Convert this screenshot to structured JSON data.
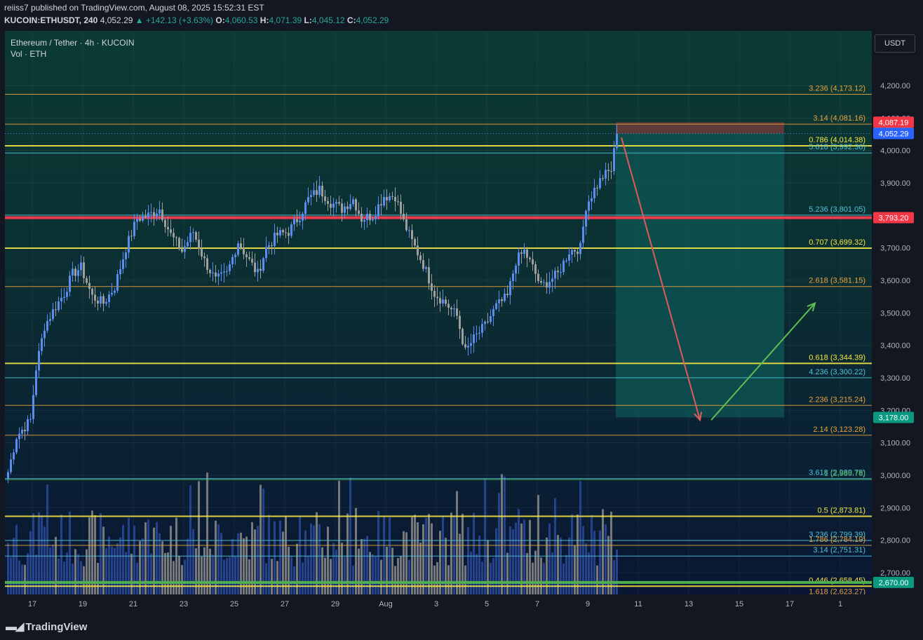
{
  "header": {
    "publish_line": "reiiss7 published on TradingView.com, August 08, 2025 15:52:31 EST",
    "symbol_line": "KUCOIN:ETHUSDT, 240",
    "last": "4,052.29",
    "change": "▲ +142.13 (+3.63%)",
    "o_label": "O:",
    "o": "4,060.53",
    "h_label": "H:",
    "h": "4,071.39",
    "l_label": "L:",
    "l": "4,045.12",
    "c_label": "C:",
    "c": "4,052.29"
  },
  "legend": {
    "title": "Ethereum / Tether · 4h · KUCOIN",
    "volume": "Vol · ETH"
  },
  "currency_button": "USDT",
  "footer": {
    "brand": "TradingView"
  },
  "colors": {
    "bg": "#131722",
    "bull": "#5b8def",
    "bear": "#9e9e9e",
    "vol_bull": "#2a4a9c",
    "vol_bear": "#8a8a8a",
    "yellow": "#f5e642",
    "orange": "#e9a23b",
    "cyan": "#4fc3d9",
    "red": "#ef3b4d",
    "green": "#4caf50",
    "zone": "#0e5a57"
  },
  "chart_data": {
    "type": "candlestick",
    "symbol": "ETHUSDT",
    "interval": "4h",
    "y_range": [
      2600,
      4300
    ],
    "y_ticks": [
      2700,
      2800,
      2900,
      3000,
      3100,
      3200,
      3300,
      3400,
      3500,
      3600,
      3700,
      3800,
      3900,
      4000,
      4100,
      4200
    ],
    "y_tick_labels": [
      "2,700.00",
      "2,800.00",
      "2,900.00",
      "3,000.00",
      "3,100.00",
      "3,200.00",
      "3,300.00",
      "3,400.00",
      "3,500.00",
      "3,600.00",
      "3,700.00",
      "3,800.00",
      "3,900.00",
      "4,000.00",
      "4,100.00",
      "4,200.00"
    ],
    "x_ticks": [
      "17",
      "19",
      "21",
      "23",
      "25",
      "27",
      "29",
      "Aug",
      "3",
      "5",
      "7",
      "9",
      "11",
      "13",
      "15",
      "17",
      "1"
    ],
    "x_tick_index": [
      9,
      27,
      45,
      63,
      81,
      99,
      117,
      135,
      153,
      171,
      189,
      207,
      225,
      243,
      261,
      279,
      297
    ],
    "total_slots": 306,
    "last_candle_index": 217,
    "waypoints": [
      {
        "i": 0,
        "p": 3010
      },
      {
        "i": 3,
        "p": 3120
      },
      {
        "i": 8,
        "p": 3170
      },
      {
        "i": 10,
        "p": 3330
      },
      {
        "i": 13,
        "p": 3460
      },
      {
        "i": 17,
        "p": 3520
      },
      {
        "i": 20,
        "p": 3560
      },
      {
        "i": 23,
        "p": 3620
      },
      {
        "i": 26,
        "p": 3640
      },
      {
        "i": 30,
        "p": 3550
      },
      {
        "i": 34,
        "p": 3530
      },
      {
        "i": 38,
        "p": 3580
      },
      {
        "i": 42,
        "p": 3700
      },
      {
        "i": 46,
        "p": 3790
      },
      {
        "i": 50,
        "p": 3800
      },
      {
        "i": 54,
        "p": 3820
      },
      {
        "i": 58,
        "p": 3740
      },
      {
        "i": 62,
        "p": 3690
      },
      {
        "i": 66,
        "p": 3750
      },
      {
        "i": 70,
        "p": 3660
      },
      {
        "i": 74,
        "p": 3600
      },
      {
        "i": 78,
        "p": 3620
      },
      {
        "i": 82,
        "p": 3720
      },
      {
        "i": 86,
        "p": 3660
      },
      {
        "i": 89,
        "p": 3620
      },
      {
        "i": 92,
        "p": 3700
      },
      {
        "i": 96,
        "p": 3740
      },
      {
        "i": 100,
        "p": 3750
      },
      {
        "i": 104,
        "p": 3800
      },
      {
        "i": 107,
        "p": 3850
      },
      {
        "i": 111,
        "p": 3880
      },
      {
        "i": 115,
        "p": 3840
      },
      {
        "i": 119,
        "p": 3820
      },
      {
        "i": 123,
        "p": 3850
      },
      {
        "i": 126,
        "p": 3790
      },
      {
        "i": 130,
        "p": 3800
      },
      {
        "i": 134,
        "p": 3860
      },
      {
        "i": 138,
        "p": 3860
      },
      {
        "i": 141,
        "p": 3780
      },
      {
        "i": 144,
        "p": 3720
      },
      {
        "i": 148,
        "p": 3650
      },
      {
        "i": 152,
        "p": 3560
      },
      {
        "i": 156,
        "p": 3530
      },
      {
        "i": 160,
        "p": 3490
      },
      {
        "i": 163,
        "p": 3380
      },
      {
        "i": 166,
        "p": 3420
      },
      {
        "i": 170,
        "p": 3460
      },
      {
        "i": 174,
        "p": 3520
      },
      {
        "i": 178,
        "p": 3550
      },
      {
        "i": 181,
        "p": 3660
      },
      {
        "i": 184,
        "p": 3690
      },
      {
        "i": 187,
        "p": 3640
      },
      {
        "i": 190,
        "p": 3580
      },
      {
        "i": 193,
        "p": 3600
      },
      {
        "i": 196,
        "p": 3620
      },
      {
        "i": 200,
        "p": 3690
      },
      {
        "i": 204,
        "p": 3700
      },
      {
        "i": 206,
        "p": 3830
      },
      {
        "i": 209,
        "p": 3880
      },
      {
        "i": 212,
        "p": 3920
      },
      {
        "i": 215,
        "p": 3940
      },
      {
        "i": 217,
        "p": 4052
      }
    ],
    "fib_levels": [
      {
        "label": "3.236 (4,173.12)",
        "price": 4173.12,
        "style": "orange"
      },
      {
        "label": "3.14 (4,081.16)",
        "price": 4081.16,
        "style": "orange"
      },
      {
        "label": "0.786 (4,014.38)",
        "price": 4014.38,
        "style": "yellow"
      },
      {
        "label": "5.618 (3,992.36)",
        "price": 3992.36,
        "style": "cyan"
      },
      {
        "label": "5.236 (3,801.05)",
        "price": 3801.05,
        "style": "cyan"
      },
      {
        "label": "0.707 (3,699.32)",
        "price": 3699.32,
        "style": "yellow"
      },
      {
        "label": "2.618 (3,581.15)",
        "price": 3581.15,
        "style": "orange"
      },
      {
        "label": "0.618 (3,344.39)",
        "price": 3344.39,
        "style": "yellow"
      },
      {
        "label": "4.236 (3,300.22)",
        "price": 3300.22,
        "style": "cyan"
      },
      {
        "label": "2.236 (3,215.24)",
        "price": 3215.24,
        "style": "orange"
      },
      {
        "label": "2.14 (3,123.28)",
        "price": 3123.28,
        "style": "orange"
      },
      {
        "label": "3.618 (2,989.78)",
        "price": 2989.78,
        "style": "cyan"
      },
      {
        "label": "1 (2,986.78)",
        "price": 2986.78,
        "style": "green"
      },
      {
        "label": "0.5 (2,873.81)",
        "price": 2873.81,
        "style": "yellow"
      },
      {
        "label": "3.236 (2,799.39)",
        "price": 2799.39,
        "style": "cyan"
      },
      {
        "label": "1.786 (2,784.19)",
        "price": 2784.19,
        "style": "orange"
      },
      {
        "label": "3.14 (2,751.31)",
        "price": 2751.31,
        "style": "cyan"
      },
      {
        "label": "0.446 (2,658.45)",
        "price": 2658.45,
        "style": "yellow"
      },
      {
        "label": "1.618 (2,623.27)",
        "price": 2623.27,
        "style": "orange"
      }
    ],
    "horizontal_lines": [
      {
        "price": 3793.2,
        "color": "red"
      },
      {
        "price": 2670.0,
        "color": "green"
      }
    ],
    "price_tags": [
      {
        "text": "4,087.19",
        "price": 4087.19,
        "bg": "#f23645"
      },
      {
        "text": "4,053.46",
        "price": 4053.46,
        "bg": "#787b86"
      },
      {
        "text": "4,052.29",
        "price": 4052.29,
        "bg": "#2962ff"
      },
      {
        "text": "3,793.20",
        "price": 3793.2,
        "bg": "#f23645"
      },
      {
        "text": "3,178.00",
        "price": 3178.0,
        "bg": "#089981"
      },
      {
        "text": "2,670.00",
        "price": 2670.0,
        "bg": "#089981"
      }
    ],
    "short_position": {
      "entry": 4052.29,
      "stop": 4087.19,
      "target": 3178.0,
      "from_index": 217,
      "to_index": 257
    },
    "arrows": [
      {
        "from": {
          "i": 219,
          "p": 4040
        },
        "to": {
          "i": 247,
          "p": 3170
        },
        "color": "red"
      },
      {
        "from": {
          "i": 251,
          "p": 3170
        },
        "to": {
          "i": 288,
          "p": 3530
        },
        "color": "green"
      }
    ]
  }
}
